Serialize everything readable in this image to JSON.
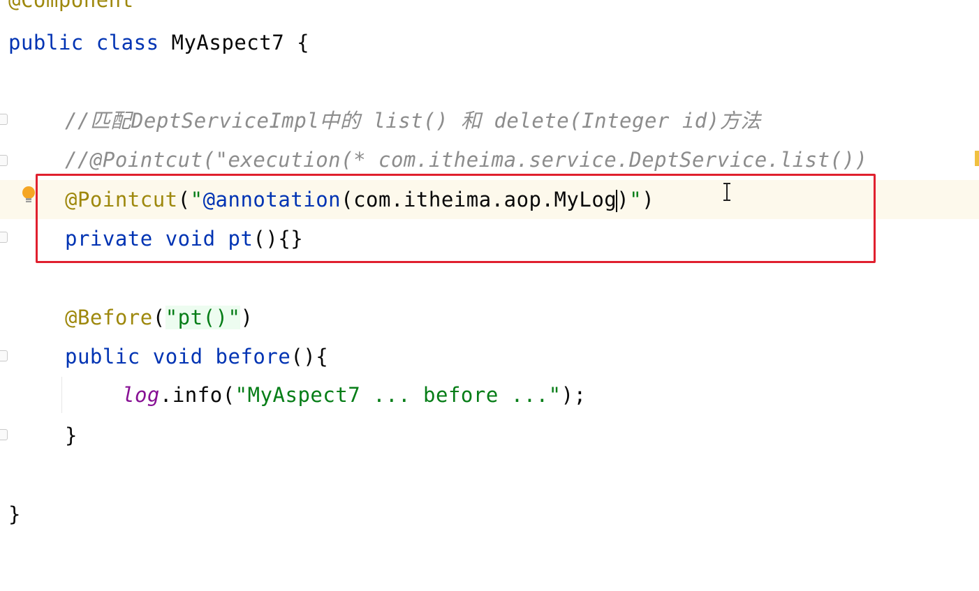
{
  "code": {
    "line_component": "@Component",
    "line_class": {
      "kw1": "public",
      "kw2": "class",
      "name": "MyAspect7",
      "brace": "{"
    },
    "comment1": "//匹配DeptServiceImpl中的 list() 和 delete(Integer id)方法",
    "comment2": "//@Pointcut(\"execution(* com.itheima.service.DeptService.list())",
    "pointcut": {
      "annotation": "@Pointcut",
      "open": "(",
      "str_start": "\"",
      "str_ann": "@annotation",
      "args_before_cursor": "(com.itheima.aop.MyLog",
      "args_after_cursor": ")",
      "str_end": "\"",
      "close": ")"
    },
    "pt_method": {
      "kw1": "private",
      "kw2": "void",
      "name": "pt",
      "rest": "(){}"
    },
    "before_ann": {
      "annotation": "@Before",
      "open": "(",
      "str": "\"pt()\"",
      "close": ")"
    },
    "before_method": {
      "kw1": "public",
      "kw2": "void",
      "name": "before",
      "rest": "(){"
    },
    "log_line": {
      "field": "log",
      "call": ".info(",
      "str": "\"MyAspect7 ... before ...\"",
      "end": ");"
    },
    "method_close": "}",
    "class_close": "}"
  },
  "colors": {
    "keyword": "#0033b3",
    "annotation": "#9e880d",
    "string": "#067d17",
    "comment": "#8c8c8c",
    "field": "#871094",
    "highlight_box": "#e0202e"
  },
  "icons": {
    "intention_bulb": "lightbulb-icon",
    "mouse_cursor": "text-cursor-icon",
    "fold_marker": "fold-marker-icon"
  }
}
